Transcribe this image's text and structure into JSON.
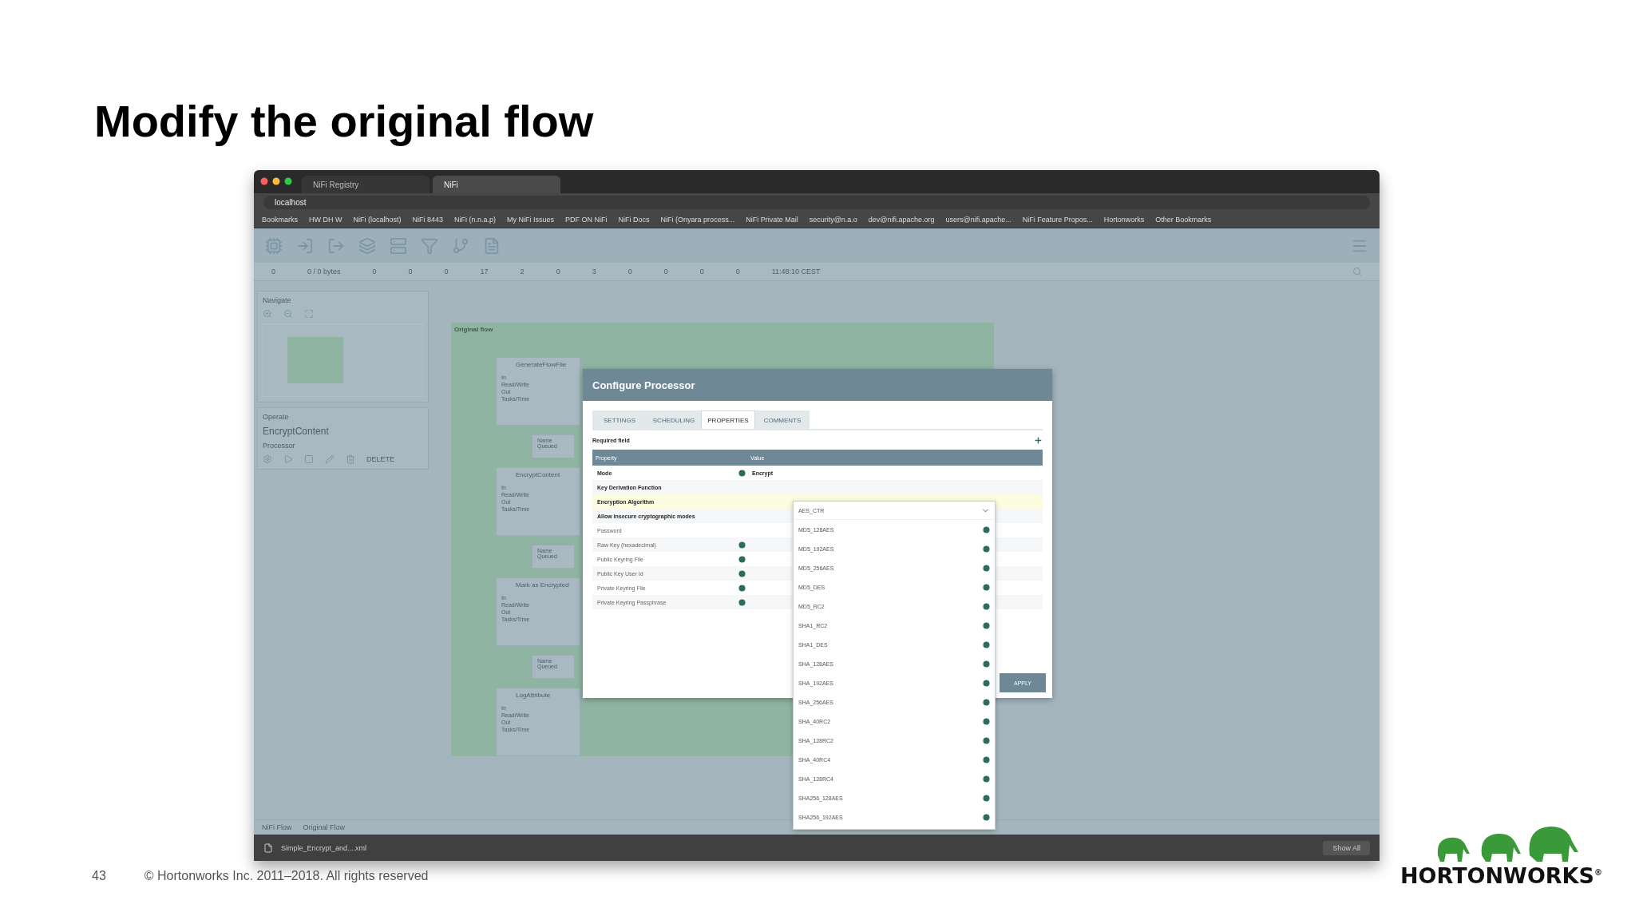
{
  "slide": {
    "title": "Modify the original flow",
    "page_number": "43",
    "copyright": "© Hortonworks Inc. 2011–2018. All rights reserved",
    "logo_text": "HORTONWORKS$^{®}$"
  },
  "browser": {
    "tabs": [
      {
        "label": "NiFi Registry",
        "selected": false
      },
      {
        "label": "NiFi",
        "selected": true
      }
    ],
    "address": "localhost",
    "bookmarks": [
      "Bookmarks",
      "HW DH W",
      "NiFi (localhost)",
      "NiFi 8443",
      "NiFi (n.n.a.p)",
      "My NiFi Issues",
      "PDF ON NiFi",
      "NiFi Docs",
      "NiFi (Onyara process...",
      "NiFi Private Mail",
      "security@n.a.o",
      "dev@nifi.apache.org",
      "users@nifi.apache...",
      "NiFi Feature Propos...",
      "Hortonworks",
      "Other Bookmarks"
    ]
  },
  "nifi": {
    "status": [
      "0",
      "0 / 0 bytes",
      "0",
      "0",
      "0",
      "17",
      "2",
      "0",
      "3",
      "0",
      "0",
      "0",
      "0",
      "11:48:10 CEST"
    ],
    "navigate_title": "Navigate",
    "operate": {
      "title": "Operate",
      "name": "EncryptContent",
      "type": "Processor",
      "delete": "DELETE"
    },
    "group": {
      "label": "Original flow",
      "processors": [
        {
          "name": "GenerateFlowFile",
          "stats": [
            "In",
            "Read/Write",
            "Out",
            "Tasks/Time"
          ]
        },
        {
          "name": "EncryptContent",
          "stats": [
            "In",
            "Read/Write",
            "Out",
            "Tasks/Time"
          ]
        },
        {
          "name": "Mark as Encrypted",
          "stats": [
            "In",
            "Read/Write",
            "Out",
            "Tasks/Time"
          ]
        },
        {
          "name": "LogAttribute",
          "stats": [
            "In",
            "Read/Write",
            "Out",
            "Tasks/Time"
          ]
        }
      ],
      "connections": [
        {
          "name": "Name",
          "queued": "Queued"
        },
        {
          "name": "Name",
          "queued": "Queued"
        },
        {
          "name": "Name",
          "queued": "Queued"
        }
      ]
    },
    "breadcrumbs": [
      "NiFi Flow",
      "Original Flow"
    ]
  },
  "dialog": {
    "title": "Configure Processor",
    "tabs": [
      {
        "label": "SETTINGS",
        "selected": false
      },
      {
        "label": "SCHEDULING",
        "selected": false
      },
      {
        "label": "PROPERTIES",
        "selected": true
      },
      {
        "label": "COMMENTS",
        "selected": false
      }
    ],
    "required_note": "Required field",
    "columns": [
      "Property",
      "Value"
    ],
    "rows": [
      {
        "property": "Mode",
        "required": true,
        "help_icon": true,
        "selected": false,
        "value": "Encrypt"
      },
      {
        "property": "Key Derivation Function",
        "required": true,
        "help_icon": false,
        "selected": false
      },
      {
        "property": "Encryption Algorithm",
        "required": true,
        "help_icon": false,
        "selected": true
      },
      {
        "property": "Allow insecure cryptographic modes",
        "required": true,
        "help_icon": false,
        "selected": false
      },
      {
        "property": "Password",
        "required": false,
        "help_icon": false,
        "selected": false
      },
      {
        "property": "Raw Key (hexadecimal)",
        "required": false,
        "help_icon": true,
        "selected": false
      },
      {
        "property": "Public Keyring File",
        "required": false,
        "help_icon": true,
        "selected": false
      },
      {
        "property": "Public Key User Id",
        "required": false,
        "help_icon": true,
        "selected": false
      },
      {
        "property": "Private Keyring File",
        "required": false,
        "help_icon": true,
        "selected": false
      },
      {
        "property": "Private Keyring Passphrase",
        "required": false,
        "help_icon": true,
        "selected": false
      }
    ],
    "apply": "APPLY",
    "dropdown": {
      "value": "AES_CTR",
      "options": [
        "MD5_128AES",
        "MD5_192AES",
        "MD5_256AES",
        "MD5_DES",
        "MD5_RC2",
        "SHA1_RC2",
        "SHA1_DES",
        "SHA_128AES",
        "SHA_192AES",
        "SHA_256AES",
        "SHA_40RC2",
        "SHA_128RC2",
        "SHA_40RC4",
        "SHA_128RC4",
        "SHA256_128AES",
        "SHA256_192AES"
      ]
    }
  },
  "downloads": {
    "file": "Simple_Encrypt_and....xml",
    "show_all": "Show All"
  }
}
